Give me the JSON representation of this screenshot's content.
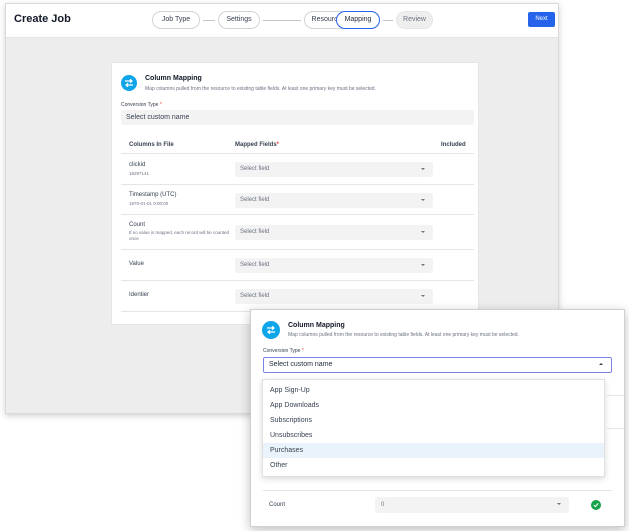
{
  "app": {
    "title": "Create Job",
    "next_label": "Next"
  },
  "steps": [
    "Job Type",
    "Settings",
    "Resource",
    "Mapping",
    "Review"
  ],
  "card": {
    "title": "Column Mapping",
    "subtitle": "Map columns pulled from the resource to existing table fields. At least one primary key must be selected.",
    "conversion_label": "Conversion Type",
    "required_mark": "*",
    "conversion_value": "Select custom name",
    "headers": {
      "columns": "Columns In File",
      "mapped": "Mapped Fields",
      "included": "Included"
    },
    "rows": [
      {
        "name": "clickid",
        "sub": "18297141",
        "placeholder": "Select field"
      },
      {
        "name": "Timestamp (UTC)",
        "sub": "1970-01-01 0:00:00",
        "placeholder": "Select field"
      },
      {
        "name": "Count",
        "sub": "If no value is mapped, each record will be counted once",
        "placeholder": "Select field"
      },
      {
        "name": "Value",
        "sub": "",
        "placeholder": "Select field"
      },
      {
        "name": "Identier",
        "sub": "",
        "placeholder": "Select field"
      }
    ]
  },
  "front": {
    "title": "Column Mapping",
    "subtitle": "Map columns pulled from the resource to existing table fields. At least one primary key must be selected.",
    "conversion_label": "Conversion Type",
    "required_mark": "*",
    "conversion_value": "Select custom name",
    "options": [
      "App Sign-Up",
      "App Downloads",
      "Subscriptions",
      "Unsubscribes",
      "Purchases",
      "Other"
    ],
    "highlighted_option": "Purchases",
    "count_row": {
      "name": "Count",
      "value": "0"
    }
  },
  "colors": {
    "primary": "#2563eb",
    "accent": "#0ea5e9",
    "success": "#16a34a",
    "required": "#ef4444"
  }
}
